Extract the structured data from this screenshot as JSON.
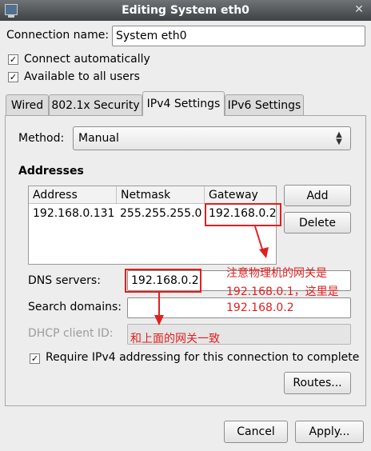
{
  "window": {
    "title": "Editing System eth0",
    "close_glyph": "✕"
  },
  "connection": {
    "name_label": "Connection name:",
    "name_value": "System eth0"
  },
  "options": {
    "connect_auto": {
      "label": "Connect automatically",
      "checked": true
    },
    "all_users": {
      "label": "Available to all users",
      "checked": true
    }
  },
  "tabs": [
    {
      "label": "Wired"
    },
    {
      "label": "802.1x Security"
    },
    {
      "label": "IPv4 Settings",
      "active": true
    },
    {
      "label": "IPv6 Settings"
    }
  ],
  "ipv4": {
    "method_label": "Method:",
    "method_value": "Manual",
    "addresses_heading": "Addresses",
    "columns": [
      "Address",
      "Netmask",
      "Gateway"
    ],
    "row": {
      "address": "192.168.0.131",
      "netmask": "255.255.255.0",
      "gateway": "192.168.0.2"
    },
    "add_button": "Add",
    "delete_button": "Delete",
    "dns_label": "DNS servers:",
    "dns_value": "192.168.0.2",
    "search_label": "Search domains:",
    "search_value": "",
    "dhcp_label": "DHCP client ID:",
    "dhcp_value": "",
    "require_label": "Require IPv4 addressing for this connection to complete",
    "require_checked": true,
    "routes_button": "Routes..."
  },
  "footer": {
    "cancel": "Cancel",
    "apply": "Apply..."
  },
  "annotations": {
    "note1_line1": "注意物理机的网关是",
    "note1_line2": "192.168.0.1，这里是",
    "note1_line3": "192.168.0.2",
    "note2": "和上面的网关一致",
    "color": "#e02020"
  },
  "icons": {
    "window": "network-icon",
    "check": "✓",
    "combo_arrows": "▲▼"
  }
}
